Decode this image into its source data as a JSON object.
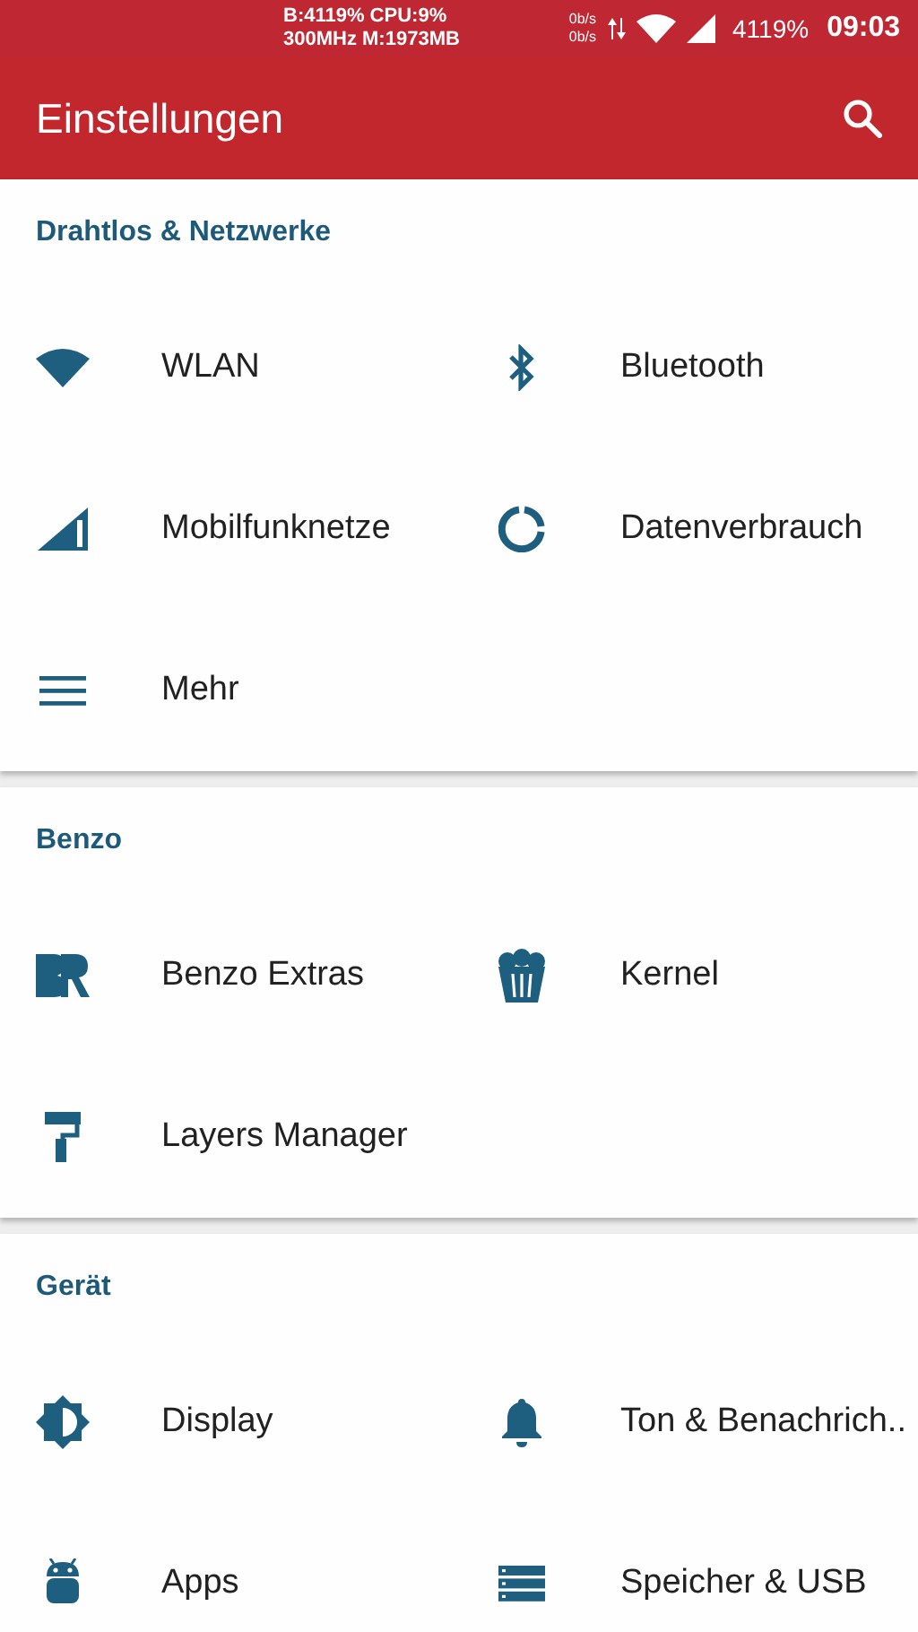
{
  "status_bar": {
    "stats_line_1": "B:4119% CPU:9%",
    "stats_line_2": "300MHz M:1973MB",
    "speed_up": "0b/s",
    "speed_down": "0b/s",
    "battery": "4119%",
    "time": "09:03"
  },
  "app_bar": {
    "title": "Einstellungen"
  },
  "sections": [
    {
      "title": "Drahtlos & Netzwerke",
      "items": [
        {
          "label": "WLAN"
        },
        {
          "label": "Bluetooth"
        },
        {
          "label": "Mobilfunknetze"
        },
        {
          "label": "Datenverbrauch"
        },
        {
          "label": "Mehr"
        }
      ]
    },
    {
      "title": "Benzo",
      "items": [
        {
          "label": "Benzo Extras"
        },
        {
          "label": "Kernel"
        },
        {
          "label": "Layers Manager"
        }
      ]
    },
    {
      "title": "Gerät",
      "items": [
        {
          "label": "Display"
        },
        {
          "label": "Ton & Benachrich.."
        },
        {
          "label": "Apps"
        },
        {
          "label": "Speicher & USB"
        }
      ]
    }
  ]
}
